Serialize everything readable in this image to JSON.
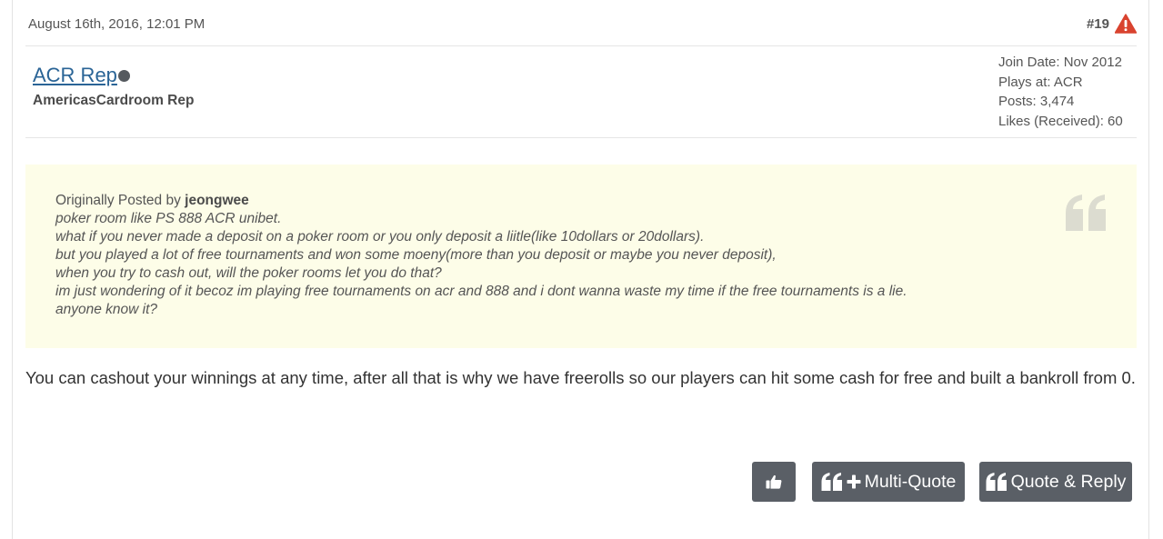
{
  "post": {
    "date": "August 16th, 2016, 12:01 PM",
    "number": "#19",
    "report_icon": "warning-triangle-icon"
  },
  "author": {
    "username": "ACR Rep",
    "user_title": "AmericasCardroom Rep",
    "status_icon": "online-status-dot-icon",
    "stats": {
      "join_date": "Join Date: Nov 2012",
      "plays_at": "Plays at: ACR",
      "posts": "Posts: 3,474",
      "likes": "Likes (Received): 60"
    }
  },
  "quote": {
    "prefix": "Originally Posted by",
    "author": "jeongwee",
    "icon": "quote-mark-icon",
    "lines": [
      "poker room like PS 888 ACR unibet.",
      "what if you never made a deposit on a poker room or you only deposit a liitle(like 10dollars or 20dollars).",
      "but you played a lot of free tournaments and won some moeny(more than you deposit or maybe you never deposit),",
      "when you try to cash out, will the poker rooms let you do that?",
      "im just wondering of it becoz im playing free tournaments on acr and 888 and i dont wanna waste my time if the free tournaments is a lie.",
      "anyone know it?"
    ]
  },
  "body": {
    "text": "You can cashout your winnings at any time, after all that is why we have freerolls so our players can hit some cash for free and built a bankroll from 0."
  },
  "actions": {
    "like_icon": "thumbs-up-icon",
    "multi_quote_label": "Multi-Quote",
    "quote_reply_label": "Quote & Reply"
  },
  "colors": {
    "link": "#2a6496",
    "button_bg": "#5a5f66",
    "quote_bg": "#fdfde8",
    "report_red": "#d9432f"
  }
}
